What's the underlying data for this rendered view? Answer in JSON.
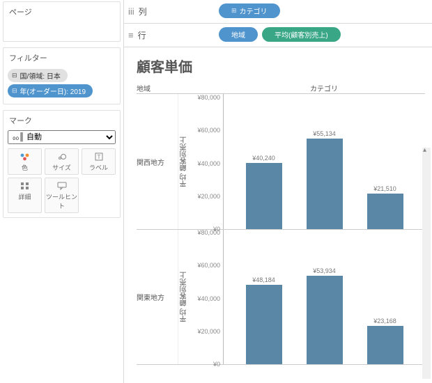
{
  "panels": {
    "pages_title": "ページ",
    "filters_title": "フィルター",
    "marks_title": "マーク"
  },
  "filters": [
    {
      "label": "国/領域: 日本",
      "style": "gray"
    },
    {
      "label": "年(オーダー日): 2019",
      "style": "blue"
    }
  ],
  "mark_type": "自動",
  "mark_cards": {
    "color": "色",
    "size": "サイズ",
    "label": "ラベル",
    "detail": "詳細",
    "tooltip": "ツールヒント"
  },
  "shelves": {
    "columns_label": "列",
    "rows_label": "行",
    "columns": [
      {
        "label": "カテゴリ",
        "style": "blue",
        "icon": "⊞"
      }
    ],
    "rows": [
      {
        "label": "地域",
        "style": "blue"
      },
      {
        "label": "平均(顧客別売上)",
        "style": "green"
      }
    ]
  },
  "viz": {
    "title": "顧客単価",
    "row_header": "地域",
    "col_header": "カテゴリ",
    "y_axis_label": "平均 顧客別売上",
    "y_ticks": [
      "¥0",
      "¥20,000",
      "¥40,000",
      "¥60,000",
      "¥80,000"
    ],
    "rows": [
      {
        "label": "関西地方",
        "bars": [
          {
            "label": "¥40,240",
            "value": 40240
          },
          {
            "label": "¥55,134",
            "value": 55134
          },
          {
            "label": "¥21,510",
            "value": 21510
          }
        ]
      },
      {
        "label": "関東地方",
        "bars": [
          {
            "label": "¥48,184",
            "value": 48184
          },
          {
            "label": "¥53,934",
            "value": 53934
          },
          {
            "label": "¥23,168",
            "value": 23168
          }
        ]
      }
    ],
    "y_max": 80000
  },
  "chart_data": {
    "type": "bar",
    "title": "顧客単価",
    "ylabel": "平均 顧客別売上",
    "ylim": [
      0,
      80000
    ],
    "row_field": "地域",
    "col_field": "カテゴリ",
    "rows": [
      "関西地方",
      "関東地方"
    ],
    "series": [
      {
        "name": "関西地方",
        "values": [
          40240,
          55134,
          21510
        ]
      },
      {
        "name": "関東地方",
        "values": [
          48184,
          53934,
          23168
        ]
      }
    ],
    "currency": "JPY"
  }
}
